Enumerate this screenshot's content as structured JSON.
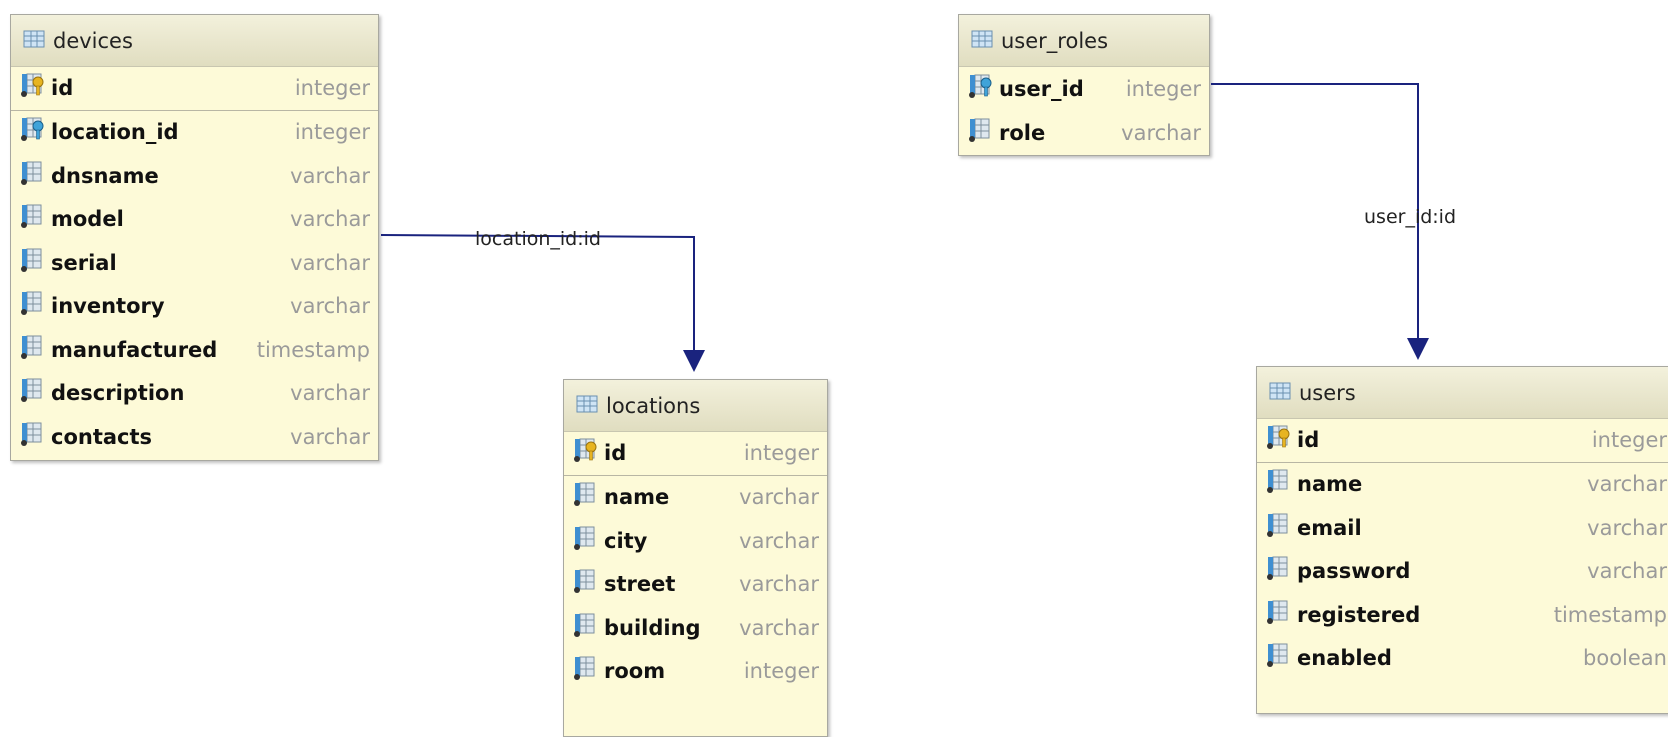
{
  "tables": {
    "devices": {
      "name": "devices",
      "columns": [
        {
          "name": "id",
          "type": "integer",
          "icon": "primary-key-icon"
        },
        {
          "name": "location_id",
          "type": "integer",
          "icon": "foreign-key-icon"
        },
        {
          "name": "dnsname",
          "type": "varchar",
          "icon": "column-icon"
        },
        {
          "name": "model",
          "type": "varchar",
          "icon": "column-icon"
        },
        {
          "name": "serial",
          "type": "varchar",
          "icon": "column-icon"
        },
        {
          "name": "inventory",
          "type": "varchar",
          "icon": "column-icon"
        },
        {
          "name": "manufactured",
          "type": "timestamp",
          "icon": "column-icon"
        },
        {
          "name": "description",
          "type": "varchar",
          "icon": "column-icon"
        },
        {
          "name": "contacts",
          "type": "varchar",
          "icon": "column-icon"
        }
      ]
    },
    "locations": {
      "name": "locations",
      "columns": [
        {
          "name": "id",
          "type": "integer",
          "icon": "primary-key-icon"
        },
        {
          "name": "name",
          "type": "varchar",
          "icon": "column-icon"
        },
        {
          "name": "city",
          "type": "varchar",
          "icon": "column-icon"
        },
        {
          "name": "street",
          "type": "varchar",
          "icon": "column-icon"
        },
        {
          "name": "building",
          "type": "varchar",
          "icon": "column-icon"
        },
        {
          "name": "room",
          "type": "integer",
          "icon": "column-icon"
        }
      ]
    },
    "user_roles": {
      "name": "user_roles",
      "columns": [
        {
          "name": "user_id",
          "type": "integer",
          "icon": "foreign-key-icon"
        },
        {
          "name": "role",
          "type": "varchar",
          "icon": "column-icon"
        }
      ]
    },
    "users": {
      "name": "users",
      "columns": [
        {
          "name": "id",
          "type": "integer",
          "icon": "primary-key-icon"
        },
        {
          "name": "name",
          "type": "varchar",
          "icon": "column-icon"
        },
        {
          "name": "email",
          "type": "varchar",
          "icon": "column-icon"
        },
        {
          "name": "password",
          "type": "varchar",
          "icon": "column-icon"
        },
        {
          "name": "registered",
          "type": "timestamp",
          "icon": "column-icon"
        },
        {
          "name": "enabled",
          "type": "boolean",
          "icon": "column-icon"
        }
      ]
    }
  },
  "relations": {
    "devices_locations": "location_id:id",
    "user_roles_users": "user_id:id"
  },
  "colors": {
    "table_body": "#fdfad8",
    "relation_line": "#1a237e",
    "type_text": "#9a9a9a"
  }
}
